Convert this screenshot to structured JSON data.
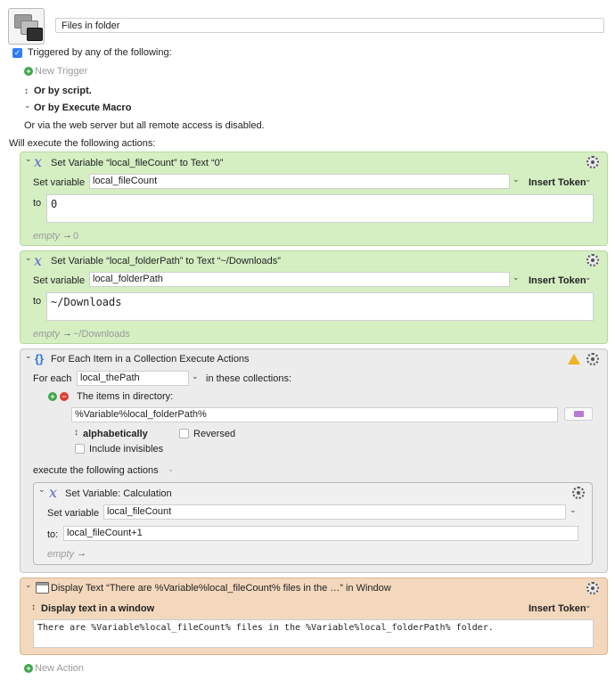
{
  "macro": {
    "title": "Files in folder"
  },
  "triggers": {
    "triggered_label": "Triggered by any of the following:",
    "new_trigger": "New Trigger",
    "or_by_script": "Or by script.",
    "or_by_execute_macro": "Or by Execute Macro",
    "web_server_note": "Or via the web server but all remote access is disabled.",
    "will_execute": "Will execute the following actions:"
  },
  "action1": {
    "title": "Set Variable “local_fileCount” to Text “0”",
    "set_variable_label": "Set variable",
    "variable": "local_fileCount",
    "insert_token": "Insert Token",
    "to_label": "to",
    "value": "0",
    "result_empty": "empty",
    "result_arrow": "→",
    "result_value": "0"
  },
  "action2": {
    "title": "Set Variable “local_folderPath” to Text “~/Downloads”",
    "set_variable_label": "Set variable",
    "variable": "local_folderPath",
    "insert_token": "Insert Token",
    "to_label": "to",
    "value": "~/Downloads",
    "result_empty": "empty",
    "result_arrow": "→",
    "result_value": "~/Downloads"
  },
  "action3": {
    "title": "For Each Item in a Collection Execute Actions",
    "for_each_label": "For each",
    "variable": "local_thePath",
    "in_collections_label": "in these collections:",
    "items_in_directory": "The items in directory:",
    "directory_path": "%Variable%local_folderPath%",
    "sort_order": "alphabetically",
    "reversed_label": "Reversed",
    "include_invisibles_label": "Include invisibles",
    "execute_label": "execute the following actions",
    "nested": {
      "title": "Set Variable: Calculation",
      "set_variable_label": "Set variable",
      "variable": "local_fileCount",
      "to_label": "to:",
      "calculation": "local_fileCount+1",
      "result_empty": "empty",
      "result_arrow": "→"
    }
  },
  "action4": {
    "title": "Display Text “There are %Variable%local_fileCount% files in the …” in Window",
    "mode": "Display text in a window",
    "insert_token": "Insert Token",
    "text": "There are %Variable%local_fileCount% files in the %Variable%local_folderPath% folder."
  },
  "footer": {
    "new_action": "New Action"
  },
  "icons": {
    "checkbox_checked": "✓",
    "chevron_down": "⌄",
    "chevron_updown": "↕",
    "plus": "+",
    "minus": "−"
  },
  "colors": {
    "set_variable_panel": "#d5efc3",
    "for_each_panel": "#ececec",
    "display_text_panel": "#f3d8bd",
    "checkbox_accent": "#2f7cf6"
  }
}
